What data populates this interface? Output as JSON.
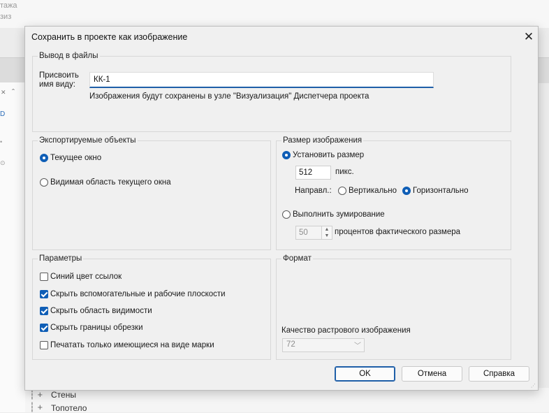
{
  "background": {
    "frag1": "тажа",
    "frag2": "зиз",
    "tree_items": [
      "Стены",
      "Топотело"
    ],
    "left_markers": [
      "✕",
      "ˆ",
      "D",
      "•",
      "⊙"
    ]
  },
  "dialog": {
    "title": "Сохранить в проекте как изображение",
    "close_icon": "✕",
    "output": {
      "group_label": "Вывод в файлы",
      "name_label": "Присвоить\nимя виду:",
      "name_value": "КК-1",
      "info_text": "Изображения будут сохранены в узле \"Визуализация\" Диспетчера проекта"
    },
    "export": {
      "group_label": "Экспортируемые объекты",
      "options": [
        {
          "label": "Текущее окно",
          "selected": true
        },
        {
          "label": "Видимая область текущего окна",
          "selected": false
        }
      ]
    },
    "size": {
      "group_label": "Размер изображения",
      "set_size_label": "Установить размер",
      "set_size_selected": true,
      "size_value": "512",
      "size_unit": "пикс.",
      "direction_label": "Направл.:",
      "vertical_label": "Вертикально",
      "vertical_selected": false,
      "horizontal_label": "Горизонтально",
      "horizontal_selected": true,
      "zoom_label": "Выполнить зумирование",
      "zoom_selected": false,
      "zoom_value": "50",
      "zoom_unit": "процентов фактического размера"
    },
    "params": {
      "group_label": "Параметры",
      "checks": [
        {
          "label": "Синий цвет ссылок",
          "checked": false
        },
        {
          "label": "Скрыть вспомогательные и рабочие плоскости",
          "checked": true
        },
        {
          "label": "Скрыть область видимости",
          "checked": true
        },
        {
          "label": "Скрыть границы обрезки",
          "checked": true
        },
        {
          "label": "Печатать только имеющиеся на виде марки",
          "checked": false
        }
      ]
    },
    "format": {
      "group_label": "Формат",
      "quality_label": "Качество растрового изображения",
      "quality_value": "72"
    },
    "buttons": {
      "ok": "OK",
      "cancel": "Отмена",
      "help": "Справка"
    },
    "accent_color": "#0f5eb6"
  }
}
